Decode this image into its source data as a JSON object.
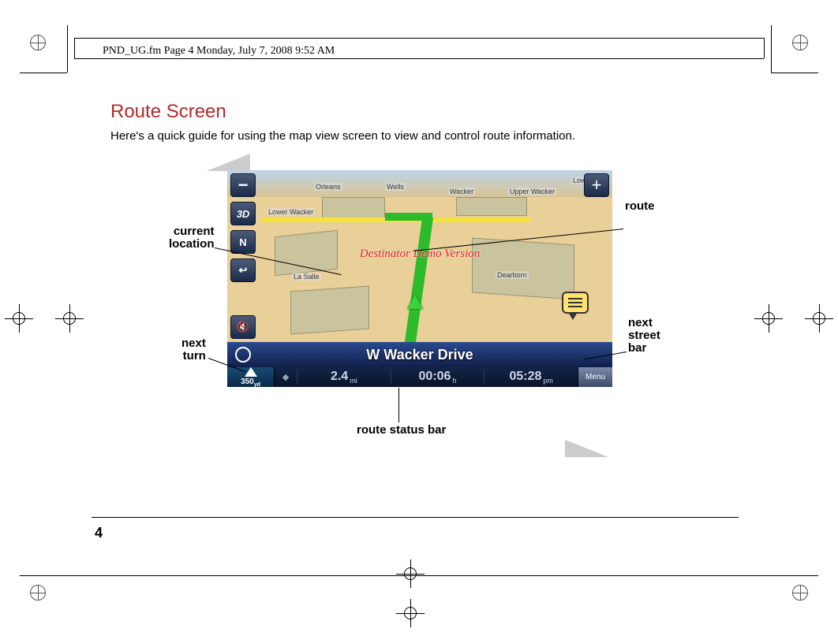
{
  "header_text": "PND_UG.fm  Page 4  Monday, July 7, 2008  9:52 AM",
  "heading": "Route Screen",
  "intro": "Here's a quick guide for using the map view screen to view and control route information.",
  "page_number": "4",
  "callouts": {
    "current_location": "current\nlocation",
    "next_turn": "next\nturn",
    "route": "route",
    "next_street_bar": "next\nstreet\nbar",
    "route_status_bar": "route status bar"
  },
  "map": {
    "demo_watermark": "Destinator Demo Version",
    "street_labels": {
      "orleans": "Orleans",
      "wells": "Wells",
      "wacker": "Wacker",
      "upper_wacker": "Upper Wacker",
      "lower_wa": "Lower Wa",
      "lower_wacker": "Lower Wacker",
      "la_salle": "La Salle",
      "dearborn": "Dearborn"
    },
    "side_buttons": {
      "zoom_out": "−",
      "view_3d": "3D",
      "compass": "N",
      "back": "↩",
      "mute": "🔇",
      "zoom_in": "+"
    },
    "street_bar": {
      "name": "W Wacker Drive"
    },
    "status_bar": {
      "turn_distance": "350",
      "turn_distance_unit": "yd",
      "remaining_distance": "2.4",
      "remaining_distance_unit": "mi",
      "remaining_time": "00:06",
      "remaining_time_unit": "h",
      "arrival_time": "05:28",
      "arrival_time_unit": "pm",
      "menu_label": "Menu"
    }
  }
}
